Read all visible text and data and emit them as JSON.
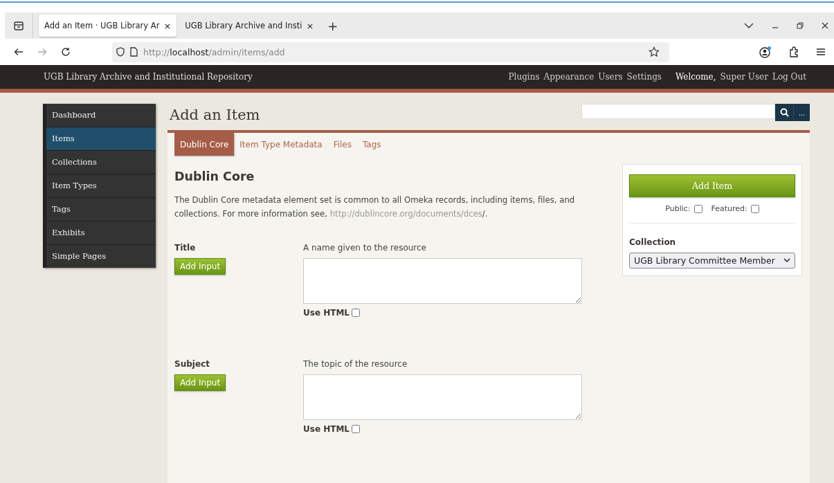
{
  "browser": {
    "tabs": [
      {
        "title": "Add an Item · UGB Library Ar",
        "selected": true,
        "close": "×"
      },
      {
        "title": "UGB Library Archive and Insti",
        "selected": false,
        "close": "×"
      }
    ],
    "new_tab": "+",
    "url": {
      "prefix": "http://",
      "host": "localhost",
      "path": "/admin/items/add"
    }
  },
  "site_header": {
    "title": "UGB Library Archive and Institutional Repository",
    "nav": [
      "Plugins",
      "Appearance",
      "Users",
      "Settings"
    ],
    "welcome": "Welcome,",
    "user": "Super User",
    "logout": "Log Out"
  },
  "sidebar": {
    "items": [
      {
        "label": "Dashboard",
        "selected": false
      },
      {
        "label": "Items",
        "selected": true
      },
      {
        "label": "Collections",
        "selected": false
      },
      {
        "label": "Item Types",
        "selected": false
      },
      {
        "label": "Tags",
        "selected": false
      },
      {
        "label": "Exhibits",
        "selected": false
      },
      {
        "label": "Simple Pages",
        "selected": false
      }
    ]
  },
  "page_title": "Add an Item",
  "search": {
    "more": "..."
  },
  "tabs": [
    {
      "label": "Dublin Core",
      "selected": true
    },
    {
      "label": "Item Type Metadata",
      "selected": false
    },
    {
      "label": "Files",
      "selected": false
    },
    {
      "label": "Tags",
      "selected": false
    }
  ],
  "section": {
    "heading": "Dublin Core",
    "description": "The Dublin Core metadata element set is common to all Omeka records, including items, files, and collections. For more information see, ",
    "link": "http://dublincore.org/documents/dces",
    "description_end": "/."
  },
  "fields": [
    {
      "label": "Title",
      "button": "Add Input",
      "hint": "A name given to the resource",
      "use_html": {
        "label": "Use HTML",
        "checked": false
      }
    },
    {
      "label": "Subject",
      "button": "Add Input",
      "hint": "The topic of the resource",
      "use_html": {
        "label": "Use HTML",
        "checked": false
      }
    }
  ],
  "side_panel": {
    "add_button": "Add Item",
    "public": {
      "label": "Public:",
      "checked": false
    },
    "featured": {
      "label": "Featured:",
      "checked": false
    },
    "collection_label": "Collection",
    "collection_value": "UGB Library Committee Member"
  }
}
